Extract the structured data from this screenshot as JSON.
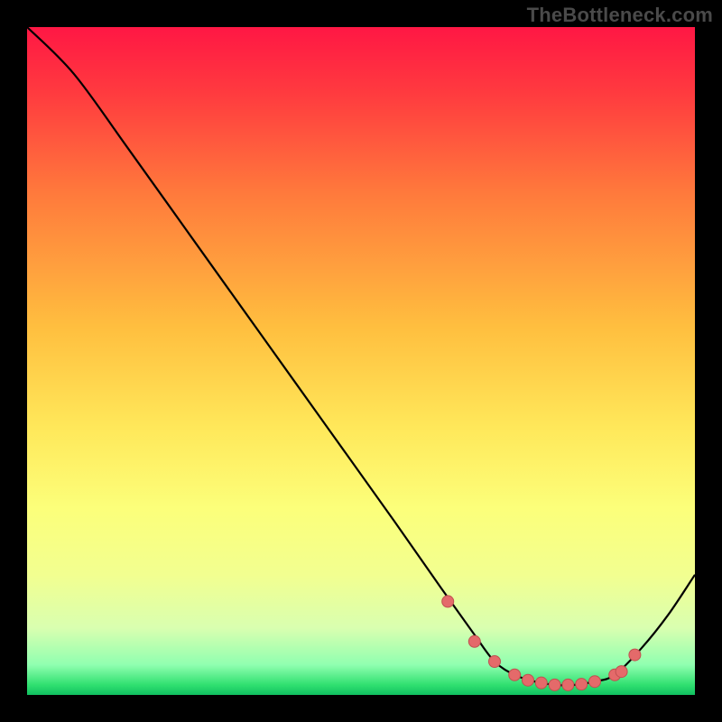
{
  "watermark": "TheBottleneck.com",
  "colors": {
    "background": "#000000",
    "curve": "#000000",
    "marker_fill": "#e46a6a",
    "marker_stroke": "#c05050"
  },
  "chart_data": {
    "type": "line",
    "title": "",
    "xlabel": "",
    "ylabel": "",
    "xlim": [
      0,
      100
    ],
    "ylim": [
      0,
      100
    ],
    "grid": false,
    "legend": false,
    "gradient_stops": [
      {
        "offset": 0.0,
        "color": "#ff1744"
      },
      {
        "offset": 0.1,
        "color": "#ff3b3f"
      },
      {
        "offset": 0.25,
        "color": "#ff7a3c"
      },
      {
        "offset": 0.45,
        "color": "#ffbf3f"
      },
      {
        "offset": 0.6,
        "color": "#ffe85a"
      },
      {
        "offset": 0.72,
        "color": "#fcff7a"
      },
      {
        "offset": 0.82,
        "color": "#f2ff90"
      },
      {
        "offset": 0.9,
        "color": "#d9ffb0"
      },
      {
        "offset": 0.955,
        "color": "#90ffb0"
      },
      {
        "offset": 0.985,
        "color": "#30e070"
      },
      {
        "offset": 1.0,
        "color": "#10c060"
      }
    ],
    "series": [
      {
        "name": "bottleneck-curve",
        "x": [
          0,
          7,
          15,
          25,
          35,
          45,
          55,
          62,
          67,
          70,
          73,
          76,
          79,
          82,
          85,
          88,
          92,
          96,
          100
        ],
        "y": [
          100,
          93,
          82,
          68,
          54,
          40,
          26,
          16,
          9,
          5,
          3,
          2,
          1.5,
          1.5,
          2,
          3,
          7,
          12,
          18
        ]
      }
    ],
    "markers": {
      "name": "highlight-points",
      "x": [
        63,
        67,
        70,
        73,
        75,
        77,
        79,
        81,
        83,
        85,
        88,
        89,
        91
      ],
      "y": [
        14,
        8,
        5,
        3,
        2.2,
        1.8,
        1.5,
        1.5,
        1.6,
        2,
        3,
        3.5,
        6
      ]
    }
  }
}
